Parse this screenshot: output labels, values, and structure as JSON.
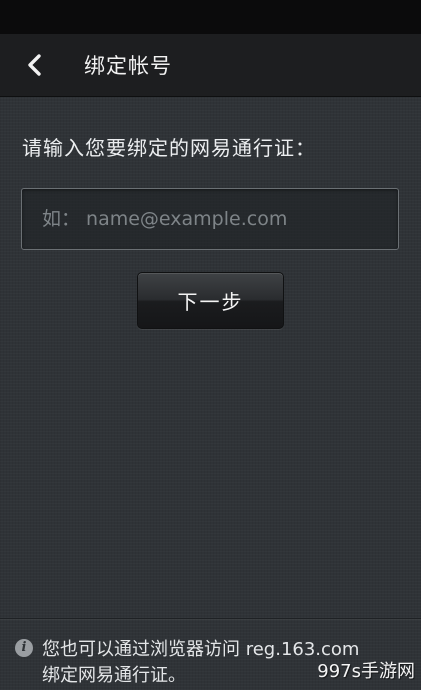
{
  "status_bar": {},
  "app_bar": {
    "back_icon": "chevron-left-icon",
    "title": "绑定帐号"
  },
  "form": {
    "prompt": "请输入您要绑定的网易通行证：",
    "account_input": {
      "value": "",
      "placeholder": "如： name@example.com"
    },
    "next_label": "下一步"
  },
  "footer": {
    "info_icon": "info-icon",
    "line1": "您也可以通过浏览器访问 reg.163.com",
    "line2": "绑定网易通行证。"
  },
  "watermark": "997s手游网",
  "colors": {
    "background": "#2f3337",
    "app_bar": "#1d1e20",
    "status_bar": "#0b0b0c",
    "text": "#eceef0",
    "placeholder": "#7e8488"
  }
}
